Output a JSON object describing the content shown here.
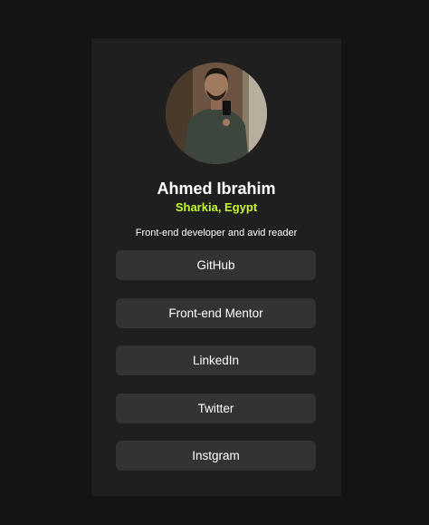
{
  "profile": {
    "name": "Ahmed Ibrahim",
    "location": "Sharkia, Egypt",
    "bio": "Front-end developer and avid reader"
  },
  "links": [
    {
      "label": "GitHub"
    },
    {
      "label": "Front-end Mentor"
    },
    {
      "label": "LinkedIn"
    },
    {
      "label": "Twitter"
    },
    {
      "label": "Instgram"
    }
  ],
  "colors": {
    "page_background": "#141414",
    "card_background": "#1f1f1f",
    "button_background": "#333333",
    "accent": "#c4f82a",
    "text": "#ffffff"
  }
}
